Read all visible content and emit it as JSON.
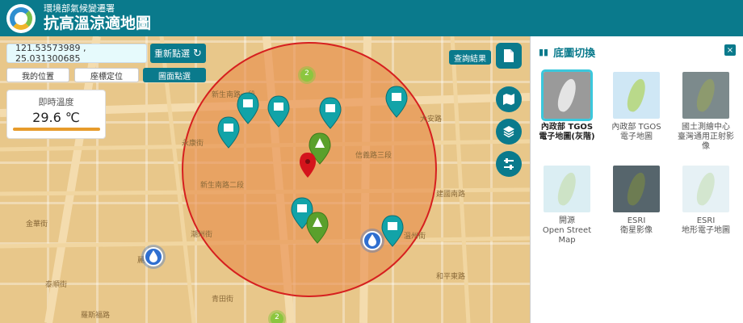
{
  "header": {
    "subtitle": "環境部氣候變遷署",
    "title": "抗高溫涼適地圖"
  },
  "controls": {
    "coordinates": "121.53573989 , 25.031300685",
    "reselect_label": "重新點選",
    "my_location_label": "我的位置",
    "coord_locate_label": "座標定位",
    "map_pick_label": "圖面點選",
    "query_results_label": "查詢結果"
  },
  "temperature": {
    "label": "即時溫度",
    "value": "29.6 ℃"
  },
  "map": {
    "cluster_labels": [
      "2",
      "2"
    ],
    "streets": [
      "新生南路一段",
      "新生南路二段",
      "信義路三段",
      "金華街",
      "潮州街",
      "麗水街",
      "永康街",
      "青田街",
      "泰順街",
      "羅斯福路",
      "大安路",
      "建國南路",
      "溫州街",
      "和平東路"
    ]
  },
  "panel": {
    "title": "底圖切換",
    "close_label": "×",
    "basemaps": [
      {
        "label": "內政部 TGOS\n電子地圖(灰階)",
        "selected": true
      },
      {
        "label": "內政部 TGOS\n電子地圖",
        "selected": false
      },
      {
        "label": "國土測繪中心\n臺灣通用正射影\n像",
        "selected": false
      },
      {
        "label": "開源\nOpen Street\nMap",
        "selected": false
      },
      {
        "label": "ESRI\n衛星影像",
        "selected": false
      },
      {
        "label": "ESRI\n地形電子地圖",
        "selected": false
      }
    ]
  },
  "colors": {
    "brand": "#0a7a8c",
    "accent": "#3bc7dc",
    "circle_fill": "#e88a4a",
    "circle_stroke": "#d61f1f",
    "pin_building": "#12a3a8",
    "pin_tree": "#5aa02c",
    "pin_water": "#2f6fd0",
    "pin_center": "#d4141c"
  }
}
